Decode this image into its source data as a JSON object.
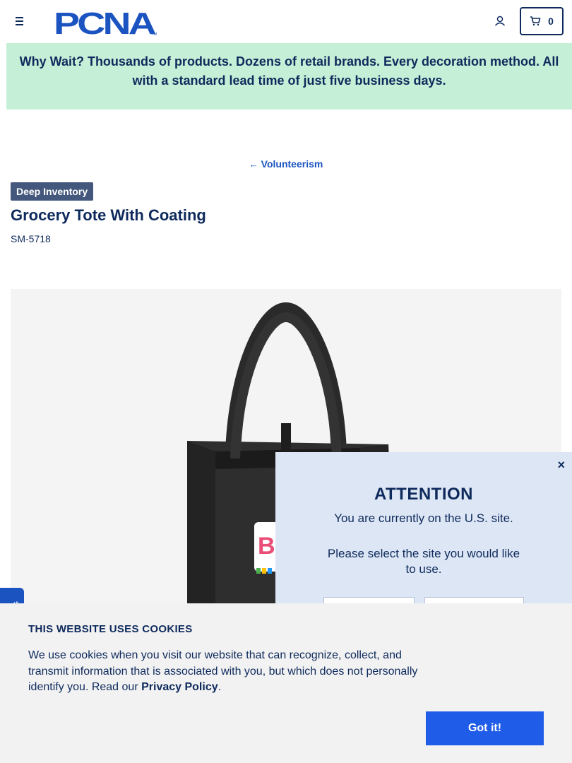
{
  "header": {
    "logo_text": "PCNA",
    "logo_tm": "TM",
    "cart_count": "0"
  },
  "banner": {
    "text": "Why Wait? Thousands of products. Dozens of retail brands. Every decoration method. All with a standard lead time of just five business days."
  },
  "breadcrumb": {
    "back_label": "Volunteerism"
  },
  "product": {
    "badge": "Deep Inventory",
    "title": "Grocery Tote With Coating",
    "sku": "SM-5718",
    "image_icon": "tote-bag-image"
  },
  "modal": {
    "close_glyph": "×",
    "title": "ATTENTION",
    "line1": "You are currently on the U.S. site.",
    "line2": "Please select the site you would like to use."
  },
  "side_tab": {
    "label": "G"
  },
  "cookie": {
    "title": "THIS WEBSITE USES COOKIES",
    "text_before": "We use cookies when you visit our website that can recognize, collect, and transmit information that is associated with you, but which does not personally identify you. Read our ",
    "link_label": "Privacy Policy",
    "text_after": ".",
    "button_label": "Got it!"
  },
  "colors": {
    "navy": "#0e2a5c",
    "banner_bg": "#c5efd6",
    "accent_blue": "#1f5ce8",
    "badge_bg": "#44587d",
    "modal_bg": "#dde6f5"
  }
}
